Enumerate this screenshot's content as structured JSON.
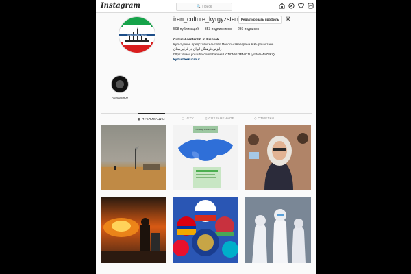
{
  "header": {
    "logo": "Instagram",
    "search_placeholder": "Поиск",
    "icons": [
      "home-icon",
      "compass-icon",
      "heart-icon",
      "messenger-icon"
    ]
  },
  "profile": {
    "username": "iran_culture_kyrgyzstan",
    "edit_label": "Редактировать профиль",
    "posts": "508 публикаций",
    "followers": "353 подписчиков",
    "following": "236 подписок",
    "name": "Cultural center IRI in Bishkek",
    "bio_line1": "Культурное представительство Посольства Ирана в Кыргызстане",
    "bio_line2": "رایزنی فرهنگی ایران در قرقیزستان",
    "bio_line3": "https://www.youtube.com/channel/UCNbMvL3PMC1UyoWAV4nZ8KQ",
    "website": "ky.bishkek.icro.ir",
    "avatar_caption": "Iranian Culture Center"
  },
  "highlights": [
    {
      "label": "Актуальное"
    }
  ],
  "tabs": [
    {
      "label": "ПУБЛИКАЦИИ",
      "icon": "grid-icon",
      "active": true
    },
    {
      "label": "IGTV",
      "icon": "tv-icon",
      "active": false
    },
    {
      "label": "СОХРАНЕННОЕ",
      "icon": "bookmark-icon",
      "active": false
    },
    {
      "label": "ОТМЕТКИ",
      "icon": "tag-icon",
      "active": false
    }
  ],
  "posts": [
    {
      "desc": "desert-military-scene"
    },
    {
      "desc": "map-poster",
      "caption": "Thursday, 4 March 2021"
    },
    {
      "desc": "woman-in-hijab"
    },
    {
      "desc": "fire-scene"
    },
    {
      "desc": "flags-circle"
    },
    {
      "desc": "medical-workers"
    }
  ],
  "colors": {
    "accent_link": "#00376b",
    "border": "#dbdbdb",
    "background": "#fafafa"
  }
}
